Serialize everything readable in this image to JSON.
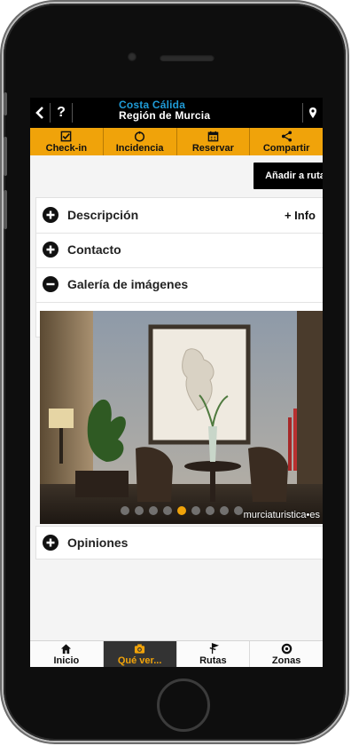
{
  "topbar": {
    "back_icon": "chevron-left-icon",
    "help_label": "?",
    "brand_line1": "Costa Cálida",
    "brand_line2": "Región de Murcia",
    "location_icon": "map-pin-icon"
  },
  "actions": [
    {
      "label": "Check-in",
      "icon": "checkbox-icon"
    },
    {
      "label": "Incidencia",
      "icon": "alert-circle-icon"
    },
    {
      "label": "Reservar",
      "icon": "calendar-icon"
    },
    {
      "label": "Compartir",
      "icon": "share-icon"
    }
  ],
  "route_button": "Añadir a ruta",
  "sections": {
    "descripcion": {
      "label": "Descripción",
      "extra": "+ Info"
    },
    "contacto": {
      "label": "Contacto"
    },
    "galeria": {
      "label": "Galería de imágenes"
    },
    "opiniones": {
      "label": "Opiniones"
    }
  },
  "gallery": {
    "watermark": "murciaturistica•es",
    "dot_count": 9,
    "active_index": 4
  },
  "bottom_nav": [
    {
      "label": "Inicio",
      "icon": "home-icon",
      "active": false
    },
    {
      "label": "Qué ver...",
      "icon": "camera-icon",
      "active": true
    },
    {
      "label": "Rutas",
      "icon": "route-icon",
      "active": false
    },
    {
      "label": "Zonas",
      "icon": "location-icon",
      "active": false
    }
  ],
  "colors": {
    "accent": "#f0a30a",
    "brand_blue": "#1f9bd7",
    "topbar_bg": "#000000"
  }
}
